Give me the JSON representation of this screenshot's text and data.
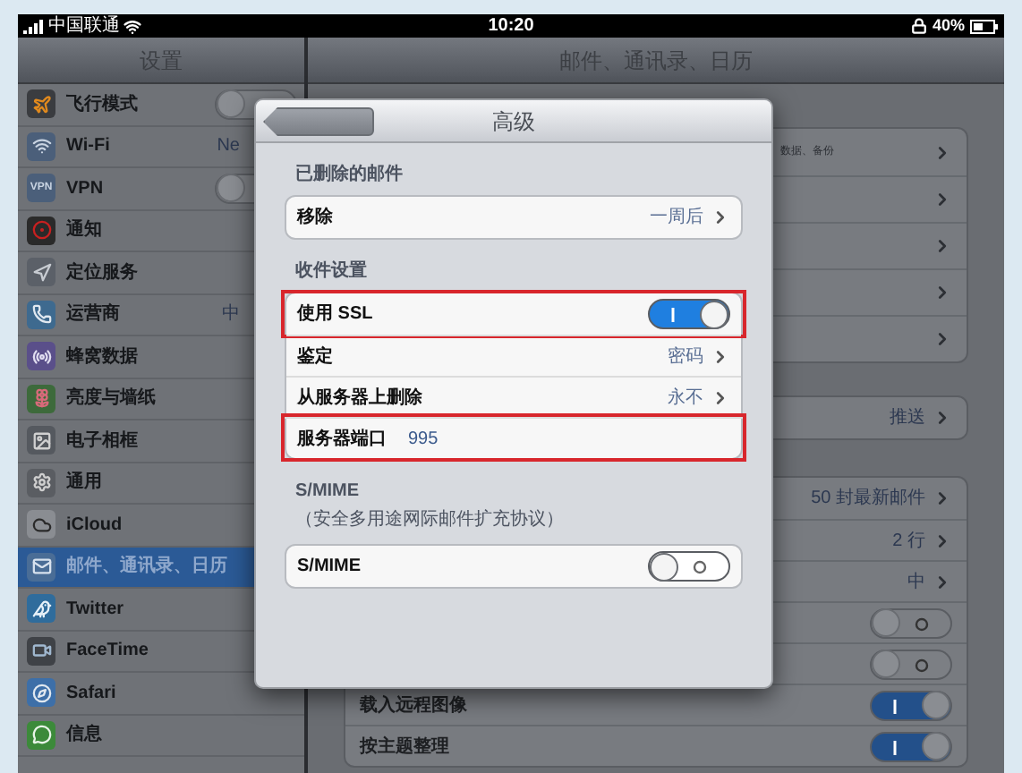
{
  "status_bar": {
    "carrier": "中国联通",
    "time": "10:20",
    "battery": "40%"
  },
  "sidebar": {
    "title": "设置",
    "items": [
      {
        "label": "飞行模式",
        "kind": "switch",
        "on": false,
        "selected": false
      },
      {
        "label": "Wi-Fi",
        "kind": "value",
        "value": "Ne",
        "selected": false
      },
      {
        "label": "VPN",
        "kind": "switch",
        "on": false,
        "selected": false,
        "icon_text": "VPN"
      },
      {
        "label": "通知",
        "kind": "link",
        "selected": false
      },
      {
        "label": "定位服务",
        "kind": "link",
        "selected": false
      },
      {
        "label": "运营商",
        "kind": "value",
        "value": "中",
        "selected": false
      },
      {
        "label": "蜂窝数据",
        "kind": "link",
        "selected": false
      },
      {
        "label": "亮度与墙纸",
        "kind": "link",
        "selected": false
      },
      {
        "label": "电子相框",
        "kind": "link",
        "selected": false
      },
      {
        "label": "通用",
        "kind": "link",
        "selected": false
      },
      {
        "label": "iCloud",
        "kind": "link",
        "selected": false
      },
      {
        "label": "邮件、通讯录、日历",
        "kind": "link",
        "selected": true
      },
      {
        "label": "Twitter",
        "kind": "link",
        "selected": false
      },
      {
        "label": "FaceTime",
        "kind": "link",
        "selected": false
      },
      {
        "label": "Safari",
        "kind": "link",
        "selected": false
      },
      {
        "label": "信息",
        "kind": "link",
        "selected": false
      }
    ]
  },
  "detail": {
    "title": "邮件、通讯录、日历",
    "groups": [
      {
        "rows": [
          {
            "kind": "link",
            "subtitle": "数据、备份"
          },
          {
            "kind": "link"
          },
          {
            "kind": "link"
          },
          {
            "kind": "link"
          },
          {
            "kind": "link"
          }
        ]
      },
      {
        "rows": [
          {
            "kind": "link",
            "value": "推送"
          }
        ]
      },
      {
        "rows": [
          {
            "kind": "link",
            "value": "50 封最新邮件"
          },
          {
            "kind": "link",
            "value": "2 行"
          },
          {
            "kind": "link",
            "value": "中"
          },
          {
            "kind": "switch",
            "on": false
          },
          {
            "kind": "switch",
            "on": false
          },
          {
            "kind": "switch",
            "label": "载入远程图像",
            "on": true
          },
          {
            "kind": "switch",
            "label": "按主题整理",
            "on": true
          }
        ]
      }
    ]
  },
  "dialog": {
    "title": "高级",
    "sections": [
      {
        "header": "已删除的邮件",
        "rows": [
          {
            "kind": "link",
            "label": "移除",
            "value": "一周后",
            "highlighted": false
          }
        ]
      },
      {
        "header": "收件设置",
        "rows": [
          {
            "kind": "switch",
            "label": "使用 SSL",
            "on": true,
            "highlighted": true
          },
          {
            "kind": "link",
            "label": "鉴定",
            "value": "密码",
            "highlighted": false
          },
          {
            "kind": "link",
            "label": "从服务器上删除",
            "value": "永不",
            "highlighted": false
          },
          {
            "kind": "field",
            "label": "服务器端口",
            "value": "995",
            "highlighted": true
          }
        ]
      },
      {
        "header": "S/MIME",
        "subheader": "（安全多用途网际邮件扩充协议）",
        "rows": [
          {
            "kind": "switch",
            "label": "S/MIME",
            "on": false,
            "highlighted": false
          }
        ]
      }
    ]
  }
}
